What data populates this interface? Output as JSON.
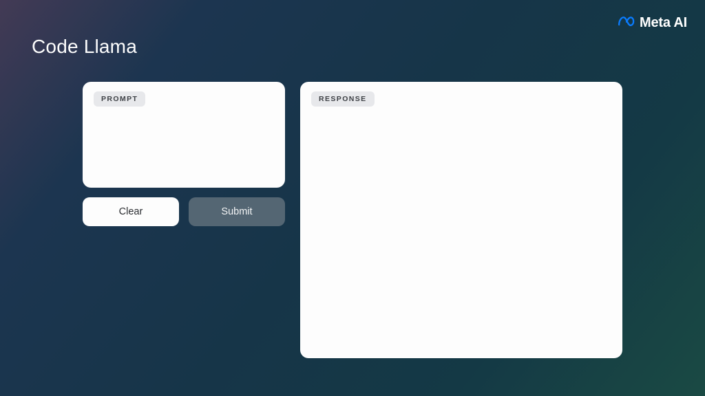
{
  "brand": {
    "name": "Meta AI",
    "logo_color": "#0a7cff"
  },
  "page": {
    "title": "Code Llama"
  },
  "panels": {
    "prompt_label": "PROMPT",
    "response_label": "RESPONSE",
    "prompt_value": "",
    "response_value": ""
  },
  "buttons": {
    "clear": "Clear",
    "submit": "Submit"
  }
}
